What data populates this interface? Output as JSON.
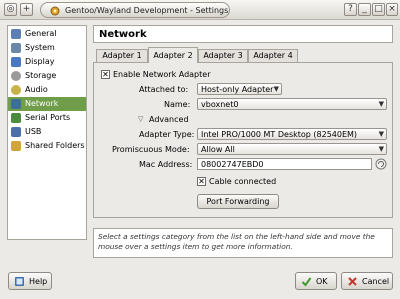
{
  "window": {
    "title": "Gentoo/Wayland Development - Settings"
  },
  "titlebar": {
    "left_buttons": [
      "◎",
      "+"
    ],
    "right_buttons": [
      "?",
      "_",
      "□",
      "×"
    ]
  },
  "sidebar": {
    "items": [
      {
        "label": "General",
        "icon": "general-icon",
        "color": "#5b7fb3"
      },
      {
        "label": "System",
        "icon": "system-icon",
        "color": "#6a86a8"
      },
      {
        "label": "Display",
        "icon": "display-icon",
        "color": "#4b78c2"
      },
      {
        "label": "Storage",
        "icon": "storage-icon",
        "color": "#9a9a9a"
      },
      {
        "label": "Audio",
        "icon": "audio-icon",
        "color": "#c9b24a"
      },
      {
        "label": "Network",
        "icon": "network-icon",
        "color": "#3d6f9d",
        "selected": true
      },
      {
        "label": "Serial Ports",
        "icon": "serial-ports-icon",
        "color": "#4c8a3e"
      },
      {
        "label": "USB",
        "icon": "usb-icon",
        "color": "#4c6fa8"
      },
      {
        "label": "Shared Folders",
        "icon": "shared-folders-icon",
        "color": "#d0a63c"
      }
    ]
  },
  "header": {
    "title": "Network"
  },
  "tabs": [
    {
      "label": "Adapter 1"
    },
    {
      "label": "Adapter 2",
      "selected": true
    },
    {
      "label": "Adapter 3"
    },
    {
      "label": "Adapter 4"
    }
  ],
  "adapter": {
    "enable_label": "Enable Network Adapter",
    "attached_label": "Attached to:",
    "attached_value": "Host-only Adapter",
    "name_label": "Name:",
    "name_value": "vboxnet0",
    "advanced_label": "Advanced",
    "type_label": "Adapter Type:",
    "type_value": "Intel PRO/1000 MT Desktop (82540EM)",
    "promisc_label": "Promiscuous Mode:",
    "promisc_value": "Allow All",
    "mac_label": "Mac Address:",
    "mac_value": "08002747EBD0",
    "cable_label": "Cable connected",
    "port_forwarding_label": "Port Forwarding"
  },
  "info": {
    "text": "Select a settings category from the list on the left-hand side and move the mouse over a settings item to get more information."
  },
  "buttons": {
    "help": "Help",
    "ok": "OK",
    "cancel": "Cancel"
  },
  "colors": {
    "selection": "#6f9d4a",
    "ok_green": "#3f9a2e",
    "cancel_red": "#c23a2b",
    "help_blue": "#3c6fb0"
  }
}
